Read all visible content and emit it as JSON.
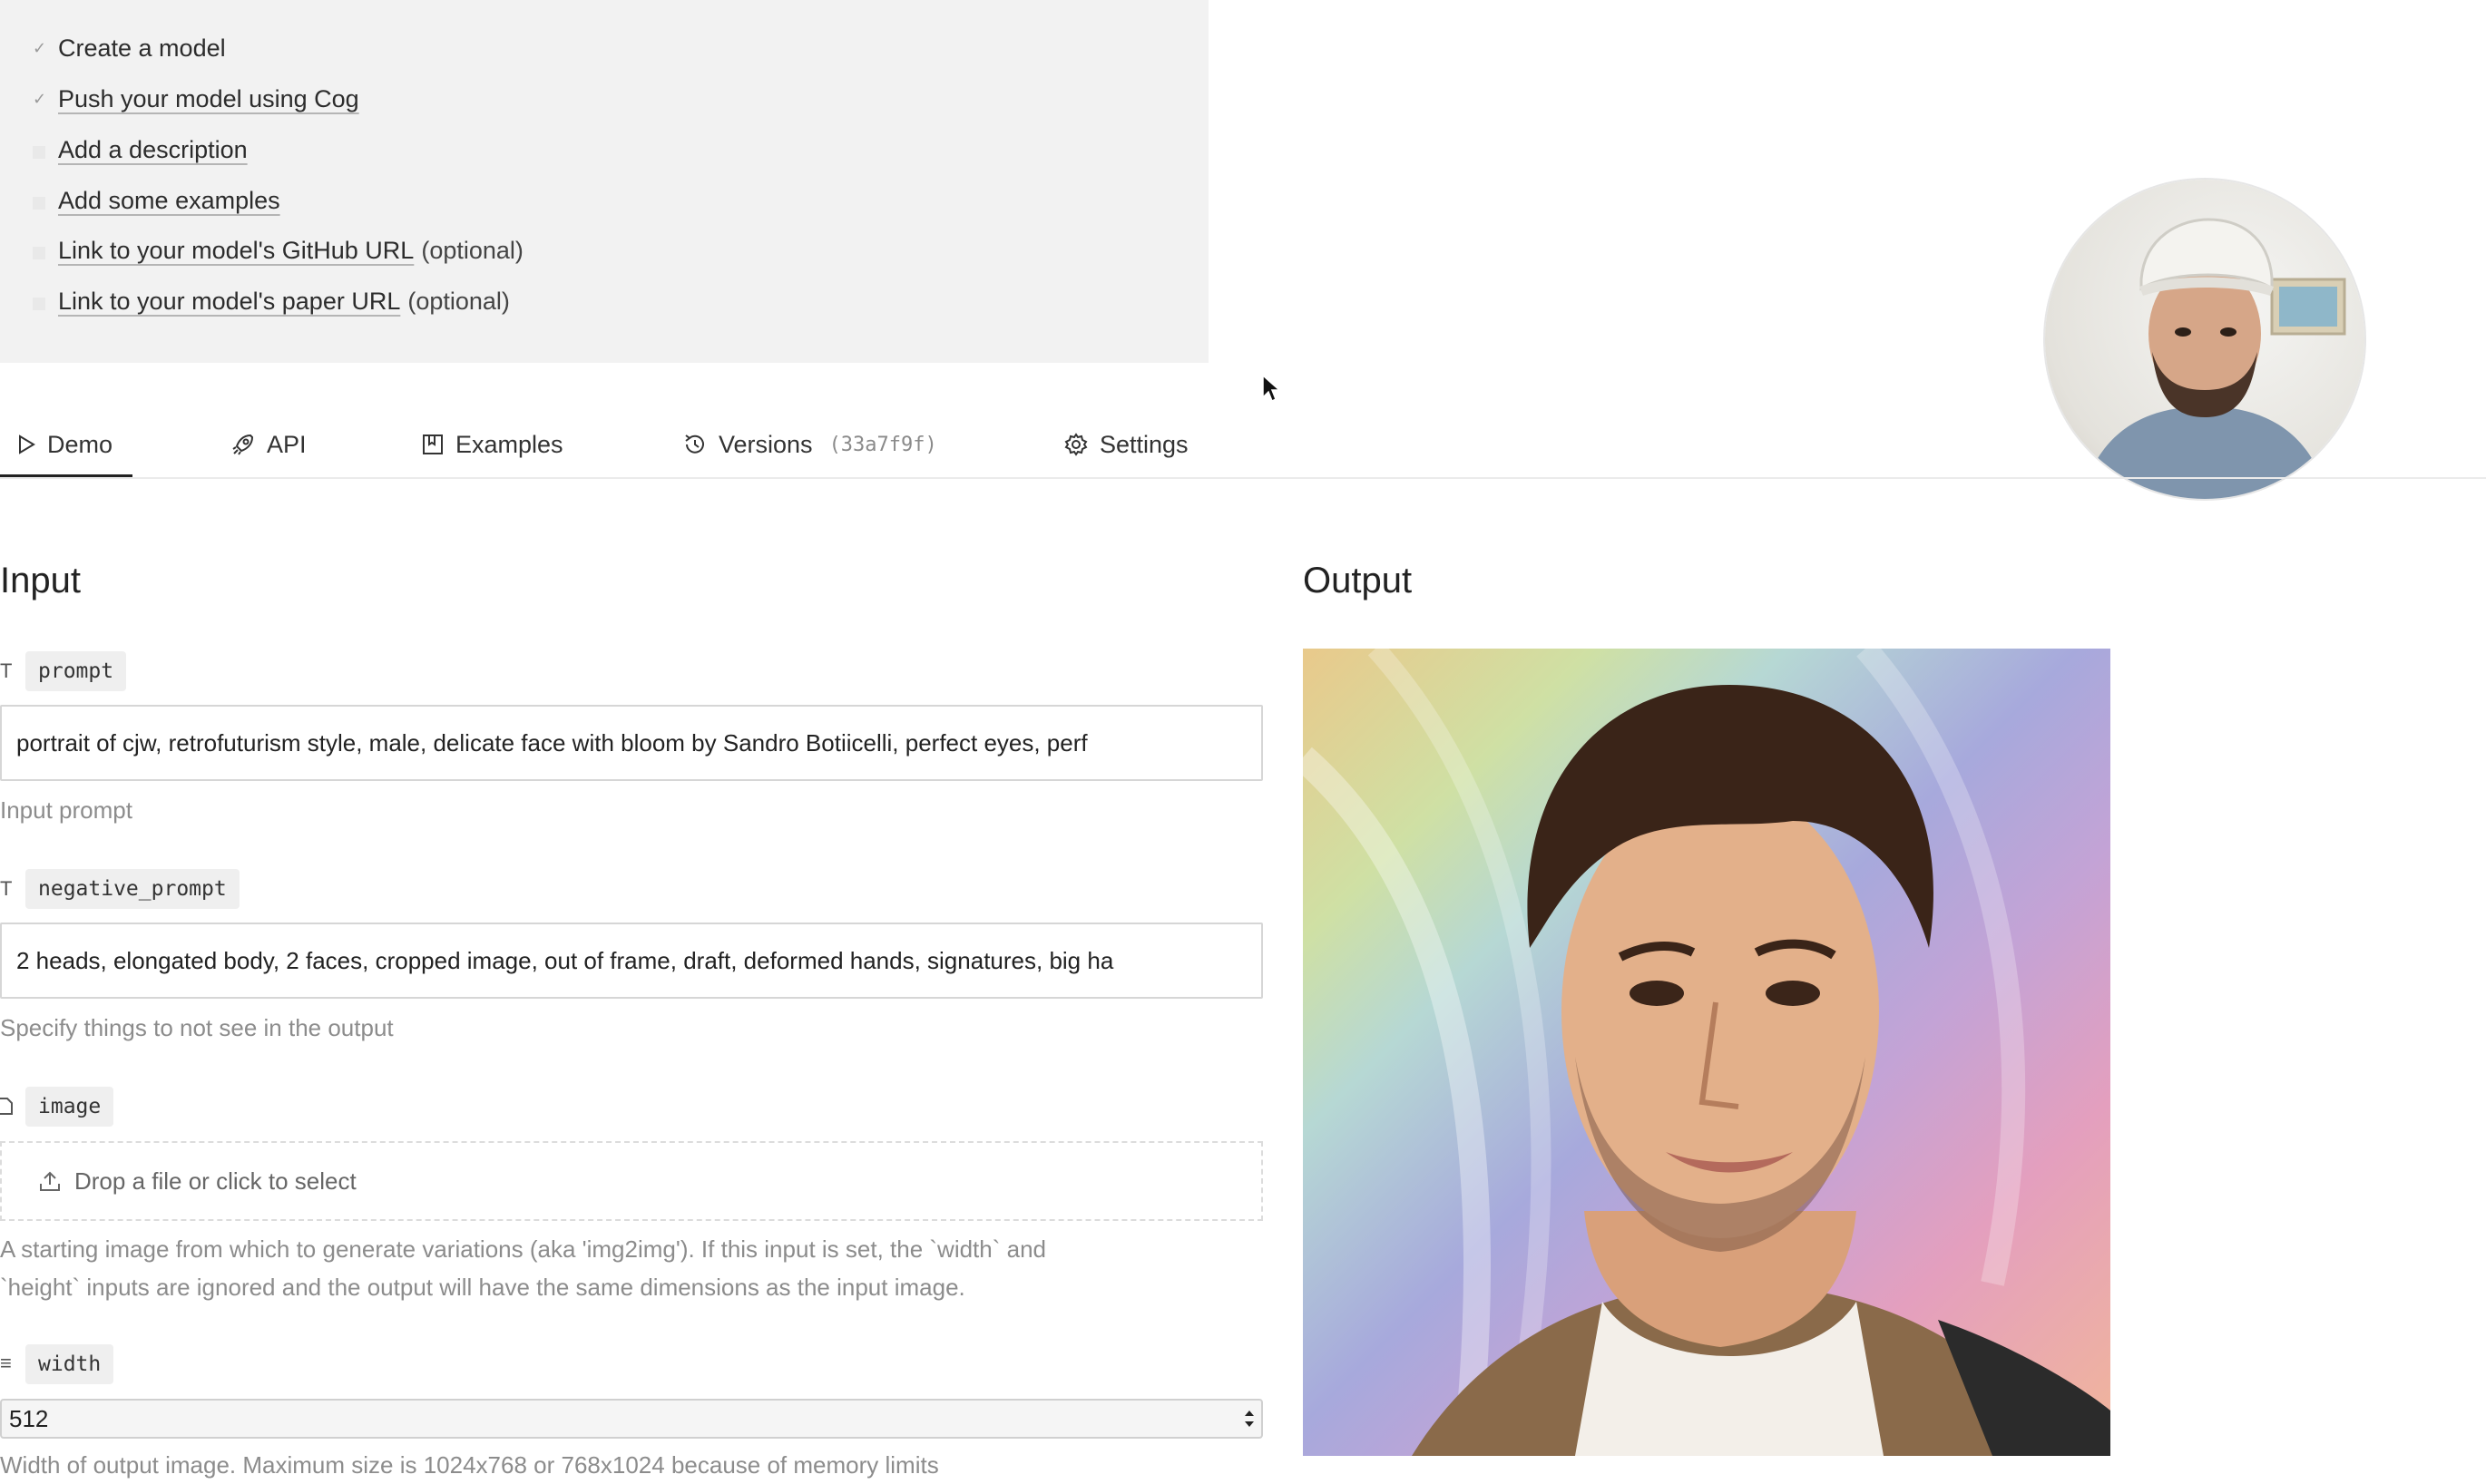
{
  "checklist": {
    "items": [
      {
        "label": "Create a model",
        "done": true,
        "suffix": ""
      },
      {
        "label": "Push your model using Cog",
        "done": true,
        "suffix": ""
      },
      {
        "label": "Add a description",
        "done": false,
        "suffix": ""
      },
      {
        "label": "Add some examples",
        "done": false,
        "suffix": ""
      },
      {
        "label": "Link to your model's GitHub URL",
        "done": false,
        "suffix": "(optional)"
      },
      {
        "label": "Link to your model's paper URL",
        "done": false,
        "suffix": "(optional)"
      }
    ]
  },
  "tabs": {
    "demo": "Demo",
    "api": "API",
    "examples": "Examples",
    "versions": "Versions",
    "version_hash": "(33a7f9f)",
    "settings": "Settings"
  },
  "input": {
    "title": "Input",
    "prompt": {
      "name": "prompt",
      "type_glyph": "T",
      "value": "portrait of cjw, retrofuturism style, male, delicate face with bloom by Sandro Botiicelli, perfect eyes, perf",
      "help": "Input prompt"
    },
    "negative_prompt": {
      "name": "negative_prompt",
      "type_glyph": "T",
      "value": "2 heads, elongated body, 2 faces, cropped image, out of frame, draft, deformed hands, signatures, big ha",
      "help": "Specify things to not see in the output"
    },
    "image": {
      "name": "image",
      "drop_label": "Drop a file or click to select",
      "help_line1": "A starting image from which to generate variations (aka 'img2img'). If this input is set, the `width` and",
      "help_line2": "`height` inputs are ignored and the output will have the same dimensions as the input image."
    },
    "width": {
      "name": "width",
      "type_glyph": "≡",
      "value": "512",
      "help": "Width of output image. Maximum size is 1024x768 or 768x1024 because of memory limits"
    }
  },
  "output": {
    "title": "Output"
  }
}
